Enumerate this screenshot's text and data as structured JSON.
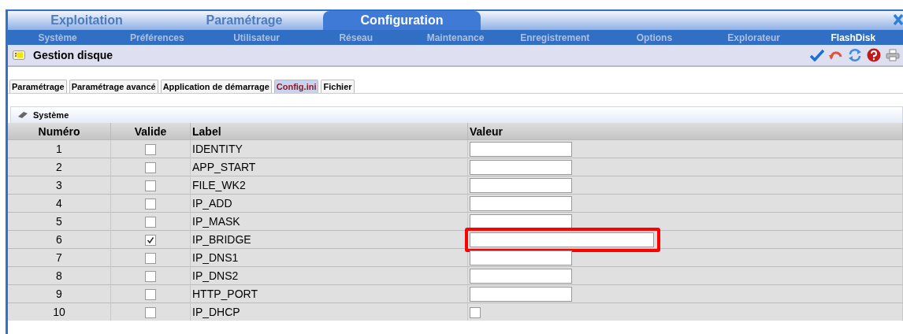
{
  "main_tabs": [
    {
      "label": "Exploitation",
      "selected": false
    },
    {
      "label": "Paramétrage",
      "selected": false
    },
    {
      "label": "Configuration",
      "selected": true
    }
  ],
  "nav": [
    {
      "label": "Système",
      "selected": false
    },
    {
      "label": "Préférences",
      "selected": false
    },
    {
      "label": "Utilisateur",
      "selected": false
    },
    {
      "label": "Réseau",
      "selected": false
    },
    {
      "label": "Maintenance",
      "selected": false
    },
    {
      "label": "Enregistrement",
      "selected": false
    },
    {
      "label": "Options",
      "selected": false
    },
    {
      "label": "Explorateur",
      "selected": false
    },
    {
      "label": "FlashDisk",
      "selected": true
    }
  ],
  "header": {
    "title": "Gestion disque"
  },
  "sub_tabs": [
    {
      "label": "Paramétrage",
      "selected": false
    },
    {
      "label": "Paramétrage avancé",
      "selected": false
    },
    {
      "label": "Application de démarrage",
      "selected": false
    },
    {
      "label": "Config.ini",
      "selected": true
    },
    {
      "label": "Fichier",
      "selected": false
    }
  ],
  "section": {
    "title": "Système"
  },
  "table": {
    "columns": [
      "Numéro",
      "Valide",
      "Label",
      "Valeur"
    ],
    "rows": [
      {
        "number": "1",
        "valid": false,
        "label": "IDENTITY",
        "value": {
          "kind": "text"
        },
        "highlighted": false
      },
      {
        "number": "2",
        "valid": false,
        "label": "APP_START",
        "value": {
          "kind": "text"
        },
        "highlighted": false
      },
      {
        "number": "3",
        "valid": false,
        "label": "FILE_WK2",
        "value": {
          "kind": "text"
        },
        "highlighted": false
      },
      {
        "number": "4",
        "valid": false,
        "label": "IP_ADD",
        "value": {
          "kind": "text"
        },
        "highlighted": false
      },
      {
        "number": "5",
        "valid": false,
        "label": "IP_MASK",
        "value": {
          "kind": "text"
        },
        "highlighted": false
      },
      {
        "number": "6",
        "valid": true,
        "label": "IP_BRIDGE",
        "value": {
          "kind": "text"
        },
        "highlighted": true
      },
      {
        "number": "7",
        "valid": false,
        "label": "IP_DNS1",
        "value": {
          "kind": "text"
        },
        "highlighted": false
      },
      {
        "number": "8",
        "valid": false,
        "label": "IP_DNS2",
        "value": {
          "kind": "text"
        },
        "highlighted": false
      },
      {
        "number": "9",
        "valid": false,
        "label": "HTTP_PORT",
        "value": {
          "kind": "text"
        },
        "highlighted": false
      },
      {
        "number": "10",
        "valid": false,
        "label": "IP_DHCP",
        "value": {
          "kind": "checkbox",
          "checked": false
        },
        "highlighted": false
      }
    ]
  }
}
